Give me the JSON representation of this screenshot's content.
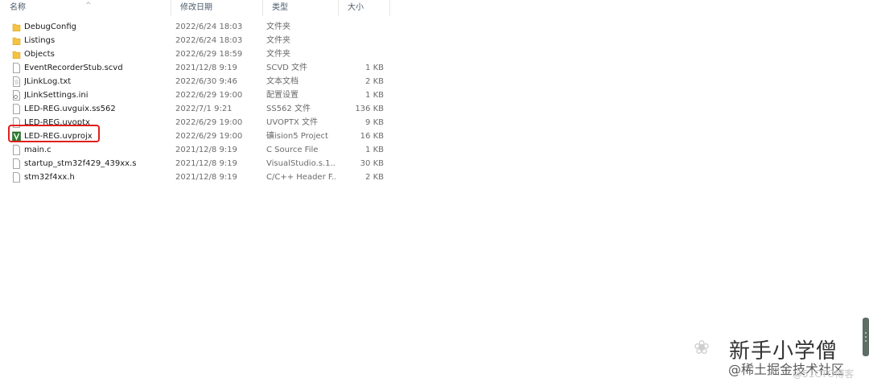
{
  "header": {
    "columns": {
      "name": "名称",
      "date": "修改日期",
      "type": "类型",
      "size": "大小"
    },
    "sort_indicator": "^"
  },
  "files": [
    {
      "name": "DebugConfig",
      "date": "2022/6/24 18:03",
      "type": "文件夹",
      "size": "",
      "icon": "folder-icon"
    },
    {
      "name": "Listings",
      "date": "2022/6/24 18:03",
      "type": "文件夹",
      "size": "",
      "icon": "folder-icon"
    },
    {
      "name": "Objects",
      "date": "2022/6/29 18:59",
      "type": "文件夹",
      "size": "",
      "icon": "folder-icon"
    },
    {
      "name": "EventRecorderStub.scvd",
      "date": "2021/12/8 9:19",
      "type": "SCVD 文件",
      "size": "1 KB",
      "icon": "file-icon"
    },
    {
      "name": "JLinkLog.txt",
      "date": "2022/6/30 9:46",
      "type": "文本文档",
      "size": "2 KB",
      "icon": "text-file-icon"
    },
    {
      "name": "JLinkSettings.ini",
      "date": "2022/6/29 19:00",
      "type": "配置设置",
      "size": "1 KB",
      "icon": "settings-file-icon"
    },
    {
      "name": "LED-REG.uvguix.ss562",
      "date": "2022/7/1 9:21",
      "type": "SS562 文件",
      "size": "136 KB",
      "icon": "file-icon"
    },
    {
      "name": "LED-REG.uvoptx",
      "date": "2022/6/29 19:00",
      "type": "UVOPTX 文件",
      "size": "9 KB",
      "icon": "file-icon"
    },
    {
      "name": "LED-REG.uvprojx",
      "date": "2022/6/29 19:00",
      "type": "礦ision5 Project",
      "size": "16 KB",
      "icon": "keil-project-icon"
    },
    {
      "name": "main.c",
      "date": "2021/12/8 9:19",
      "type": "C Source File",
      "size": "1 KB",
      "icon": "file-icon"
    },
    {
      "name": "startup_stm32f429_439xx.s",
      "date": "2021/12/8 9:19",
      "type": "VisualStudio.s.1...",
      "size": "30 KB",
      "icon": "file-icon"
    },
    {
      "name": "stm32f4xx.h",
      "date": "2021/12/8 9:19",
      "type": "C/C++ Header F...",
      "size": "2 KB",
      "icon": "file-icon"
    }
  ],
  "colors": {
    "highlight": "#e0201b",
    "folder": "#f5c342",
    "keil": "#2e7d32"
  },
  "watermark": {
    "title": "新手小学僧",
    "subtitle": "@稀土掘金技术社区",
    "blog": "@51CTO博客"
  }
}
